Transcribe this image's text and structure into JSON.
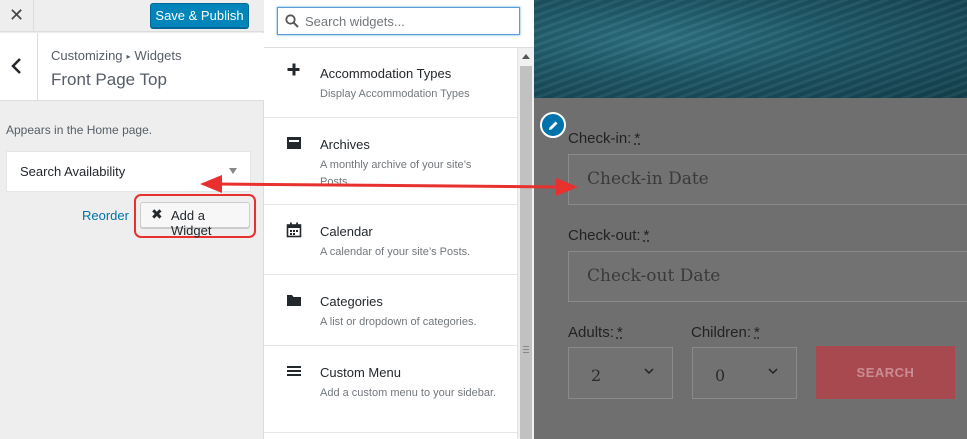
{
  "topbar": {
    "close_glyph": "✕",
    "save_label": "Save & Publish"
  },
  "section": {
    "breadcrumb_root": "Customizing",
    "breadcrumb_sep": "▸",
    "breadcrumb_child": "Widgets",
    "title": "Front Page Top"
  },
  "sidebar": {
    "appears_text": "Appears in the Home page.",
    "widget_title": "Search Availability",
    "reorder_label": "Reorder",
    "add_widget_label": "Add a Widget",
    "add_widget_glyph": "✖"
  },
  "widgets_panel": {
    "search_placeholder": "Search widgets...",
    "items": [
      {
        "title": "Accommodation Types",
        "description": "Display Accommodation Types",
        "icon": "plus-icon"
      },
      {
        "title": "Archives",
        "description": "A monthly archive of your site’s Posts.",
        "icon": "archive-icon"
      },
      {
        "title": "Calendar",
        "description": "A calendar of your site’s Posts.",
        "icon": "calendar-icon"
      },
      {
        "title": "Categories",
        "description": "A list or dropdown of categories.",
        "icon": "folder-icon"
      },
      {
        "title": "Custom Menu",
        "description": "Add a custom menu to your sidebar.",
        "icon": "menu-icon"
      }
    ]
  },
  "preview": {
    "checkin_label": "Check-in:",
    "checkin_placeholder": "Check-in Date",
    "checkout_label": "Check-out:",
    "checkout_placeholder": "Check-out Date",
    "adults_label": "Adults:",
    "adults_value": "2",
    "children_label": "Children:",
    "children_value": "0",
    "required_mark": "*",
    "search_label": "SEARCH"
  },
  "colors": {
    "primary_button": "#0085ba",
    "annotation_red": "#e8312e",
    "link": "#0073aa"
  }
}
